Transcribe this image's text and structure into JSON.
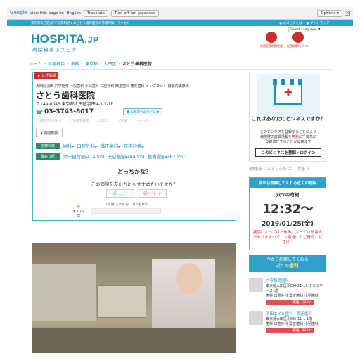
{
  "translate_bar": {
    "brand": "Google",
    "view_text": "View this page in:",
    "language": "English",
    "translate_label": "Translate",
    "turn_off_label": "Turn off for: Japanese",
    "options_label": "Options ▾",
    "close_glyph": "×"
  },
  "topbar": {
    "text": "東京都大田区|穴守稲荷駅近くのさとう歯科医院の診療時間・アクセス",
    "links": [
      "● ホスピタとは",
      "● サイトマップ"
    ]
  },
  "header": {
    "logo": "HOSPITA",
    "logo_suffix": ".JP",
    "logo_sub": "病院検索ホスピタ",
    "search_placeholder": "Select Language ▼",
    "icons": [
      {
        "label": "新規医療機関登録",
        "icon": "hospital-register-icon"
      },
      {
        "label": "医療機関ログイン",
        "icon": "hospital-login-icon"
      }
    ]
  },
  "breadcrumb": [
    "ホーム",
    "診療科目",
    "歯科",
    "東京都",
    "大田区"
  ],
  "breadcrumb_sep": "›",
  "breadcrumb_current": "さとう歯科医院",
  "clinic": {
    "badge": "★ 公式情報",
    "tags": "大田区羽田 穴守稲荷 一般歯科 小児歯科 口腔外科 矯正歯科 審美歯科 インプラント 静脈内鎮静法",
    "name": "さとう歯科医院",
    "zip": "〒144-0043 東京都大田区羽田4-3-3-1F",
    "tel_icon": "☎",
    "tel": "03-3743-8017",
    "hp": "▣ 公式ホームページ ▶",
    "mini_links": [
      "□ 電話で問合わせ",
      "□ 地図を確認",
      "□ 口コミ",
      "□ 写真",
      "□ クーポン"
    ],
    "tab": "▾ 病院概要",
    "dept_label": "診療科目",
    "depts": [
      "歯科▸",
      "口腔外科▸",
      "矯正歯科▸",
      "在宅診療▸"
    ],
    "station_label": "最寄り駅",
    "stations": [
      "穴守稲荷駅▸(140m)",
      "天空橋駅▸(640m)",
      "整備場駅▸(670m)"
    ]
  },
  "question": {
    "title": "どっちかな？",
    "text": "この病院を友だちにもすすめたいですか？",
    "yes": "はい",
    "no": "いいえ",
    "yes_icon": "☺",
    "no_icon": "☹",
    "result": "☺ はい 0%  ☹ いいえ 0%",
    "recommend_star": "★",
    "recommend": "オススメ度"
  },
  "sidebar": {
    "ad_title": "これはあなたのビジネスですか？",
    "ad_text_a": "このビジネスを登録することにより",
    "ad_text_b": "病院院の詳細情報を",
    "ad_text_red": "無料",
    "ad_text_c": "にて簡単に",
    "ad_text_d": "登録修正することが出来ます",
    "ad_button": "このビジネスを登録・ログイン",
    "stats_a": "総閲覧数：3,870 ｜ 今月：",
    "stats_red": "33",
    "stats_b": " ｜ 先週：1",
    "clock_header": "今から診察してくれる近くの病院",
    "clock_sub": "只今の時刻",
    "time": "12:32〜",
    "date": "2019/01/25(金)",
    "note": "病院によってはお休みに入っている場合がありますので、お電話にてご確認ください。",
    "near_text_a": "今から診察してくれる",
    "near_text_b": "近くの",
    "near_text_b2": "歯科",
    "cards": [
      {
        "title": "穴守稲荷歯科",
        "addr": "東京都大田区羽田4-21-11 タカラネ－ス1階",
        "depts": "歯科 口腔外科 矯正歯科 小児歯科",
        "dist": "距離：329m"
      },
      {
        "title": "羽田エイル歯科・矯正歯科",
        "addr": "東京都大田区羽田6-11-1 1階",
        "depts": "歯科 口腔外科 矯正歯科 小児歯科",
        "dist": "距離：529m"
      }
    ]
  },
  "colors": {
    "accent": "#2fa0c9",
    "red": "#c8302c",
    "green": "#2b8a6a"
  }
}
